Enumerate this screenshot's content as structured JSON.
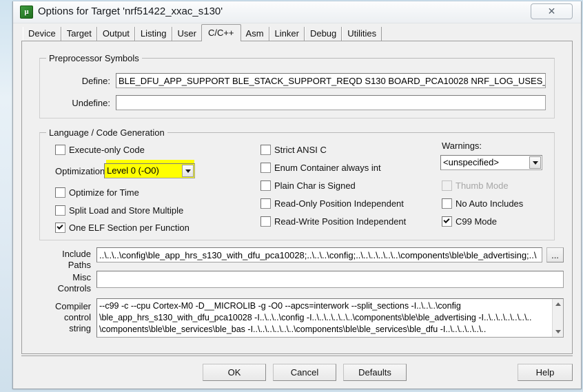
{
  "window": {
    "title": "Options for Target 'nrf51422_xxac_s130'",
    "icon": "uvision-icon",
    "close_label": "✕"
  },
  "tabs": [
    {
      "label": "Device",
      "active": false
    },
    {
      "label": "Target",
      "active": false
    },
    {
      "label": "Output",
      "active": false
    },
    {
      "label": "Listing",
      "active": false
    },
    {
      "label": "User",
      "active": false
    },
    {
      "label": "C/C++",
      "active": true
    },
    {
      "label": "Asm",
      "active": false
    },
    {
      "label": "Linker",
      "active": false
    },
    {
      "label": "Debug",
      "active": false
    },
    {
      "label": "Utilities",
      "active": false
    }
  ],
  "preprocessor": {
    "group_title": "Preprocessor Symbols",
    "define_label": "Define:",
    "define_value": "BLE_DFU_APP_SUPPORT BLE_STACK_SUPPORT_REQD S130 BOARD_PCA10028 NRF_LOG_USES_UAR",
    "undefine_label": "Undefine:",
    "undefine_value": ""
  },
  "language": {
    "group_title": "Language / Code Generation",
    "left_checkboxes": [
      {
        "label": "Execute-only Code",
        "checked": false,
        "disabled": false
      },
      {
        "label": "Optimize for Time",
        "checked": false,
        "disabled": false
      },
      {
        "label": "Split Load and Store Multiple",
        "checked": false,
        "disabled": false
      },
      {
        "label": "One ELF Section per Function",
        "checked": true,
        "disabled": false
      }
    ],
    "optimization_label": "Optimization:",
    "optimization_value": "Level 0 (-O0)",
    "optimization_highlight_color": "#ffff00",
    "middle_checkboxes": [
      {
        "label": "Strict ANSI C",
        "checked": false,
        "disabled": false
      },
      {
        "label": "Enum Container always int",
        "checked": false,
        "disabled": false
      },
      {
        "label": "Plain Char is Signed",
        "checked": false,
        "disabled": false
      },
      {
        "label": "Read-Only Position Independent",
        "checked": false,
        "disabled": false
      },
      {
        "label": "Read-Write Position Independent",
        "checked": false,
        "disabled": false
      }
    ],
    "warnings_label": "Warnings:",
    "warnings_value": "<unspecified>",
    "right_checkboxes": [
      {
        "label": "Thumb Mode",
        "checked": false,
        "disabled": true
      },
      {
        "label": "No Auto Includes",
        "checked": false,
        "disabled": false
      },
      {
        "label": "C99 Mode",
        "checked": true,
        "disabled": false
      }
    ]
  },
  "paths": {
    "include_label_line1": "Include",
    "include_label_line2": "Paths",
    "include_value": "..\\..\\..\\config\\ble_app_hrs_s130_with_dfu_pca10028;..\\..\\..\\config;..\\..\\..\\..\\..\\..\\components\\ble\\ble_advertising;..\\",
    "browse_label": "...",
    "misc_label_line1": "Misc",
    "misc_label_line2": "Controls",
    "misc_value": "",
    "compiler_label_line1": "Compiler",
    "compiler_label_line2": "control",
    "compiler_label_line3": "string",
    "compiler_lines": [
      "--c99 -c --cpu Cortex-M0 -D__MICROLIB -g -O0 --apcs=interwork --split_sections -I..\\..\\..\\config",
      "\\ble_app_hrs_s130_with_dfu_pca10028 -I..\\..\\..\\config -I..\\..\\..\\..\\..\\..\\components\\ble\\ble_advertising -I..\\..\\..\\..\\..\\..\\..",
      "\\components\\ble\\ble_services\\ble_bas -I..\\..\\..\\..\\..\\..\\components\\ble\\ble_services\\ble_dfu -I..\\..\\..\\..\\..\\.."
    ]
  },
  "buttons": {
    "ok": "OK",
    "cancel": "Cancel",
    "defaults": "Defaults",
    "help": "Help"
  }
}
